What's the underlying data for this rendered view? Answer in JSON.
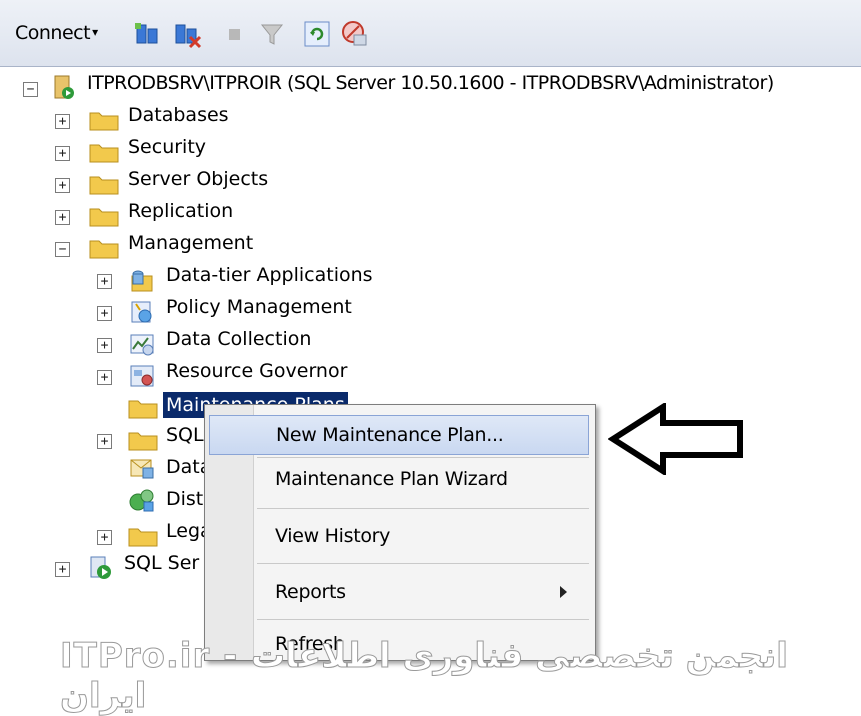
{
  "toolbar": {
    "connect_label": "Connect",
    "connect_arrow": "▾",
    "icons": [
      "connect-object-explorer-icon",
      "disconnect-icon",
      "stop-icon",
      "filter-icon",
      "refresh-icon",
      "stop-activity-icon"
    ]
  },
  "tree": {
    "server": "ITPRODBSRV\\ITPROIR (SQL Server 10.50.1600 - ITPRODBSRV\\Administrator)",
    "nodes": [
      {
        "label": "Databases",
        "state": "+"
      },
      {
        "label": "Security",
        "state": "+"
      },
      {
        "label": "Server Objects",
        "state": "+"
      },
      {
        "label": "Replication",
        "state": "+"
      },
      {
        "label": "Management",
        "state": "−"
      }
    ],
    "management_children": [
      {
        "label": "Data-tier Applications",
        "state": "+",
        "icon": "data-tier-icon"
      },
      {
        "label": "Policy Management",
        "state": "+",
        "icon": "policy-icon"
      },
      {
        "label": "Data Collection",
        "state": "+",
        "icon": "data-collection-icon"
      },
      {
        "label": "Resource Governor",
        "state": "+",
        "icon": "resource-governor-icon"
      },
      {
        "label": "Maintenance Plans",
        "state": "",
        "icon": "folder-icon"
      },
      {
        "label": "SQL",
        "state": "+",
        "icon": "folder-icon"
      },
      {
        "label": "Data",
        "state": "",
        "icon": "database-mail-icon"
      },
      {
        "label": "Dist",
        "state": "",
        "icon": "dtc-icon"
      },
      {
        "label": "Lega",
        "state": "+",
        "icon": "folder-icon"
      }
    ],
    "sql_server_agent": "SQL Ser"
  },
  "context_menu": {
    "items": [
      "New Maintenance Plan...",
      "Maintenance Plan Wizard",
      "View History",
      "Reports",
      "Refresh"
    ]
  },
  "watermark": "ITPro.ir - انجمن تخصصی فناوری اطلاعات ایران",
  "colors": {
    "selection": "#0a2a6b",
    "menu_highlight": "#c9d8f1",
    "folder": "#f2c94c"
  }
}
